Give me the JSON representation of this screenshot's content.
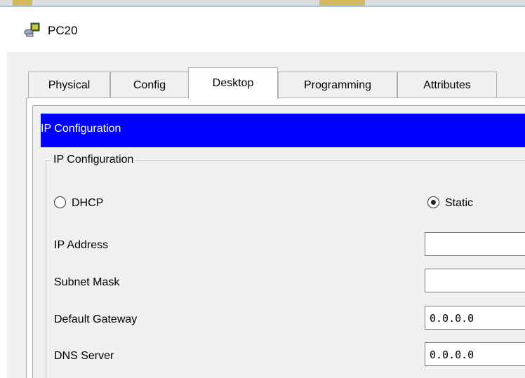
{
  "window": {
    "title": "PC20",
    "icon": "pc-device-icon"
  },
  "tabs": [
    {
      "label": "Physical",
      "active": false
    },
    {
      "label": "Config",
      "active": false
    },
    {
      "label": "Desktop",
      "active": true
    },
    {
      "label": "Programming",
      "active": false
    },
    {
      "label": "Attributes",
      "active": false
    }
  ],
  "ip_config": {
    "header": "IP Configuration",
    "group_label": "IP Configuration",
    "dhcp_label": "DHCP",
    "static_label": "Static",
    "selected_mode": "Static",
    "fields": {
      "ip_address": {
        "label": "IP Address",
        "value": ""
      },
      "subnet_mask": {
        "label": "Subnet Mask",
        "value": ""
      },
      "default_gateway": {
        "label": "Default Gateway",
        "value": "0.0.0.0"
      },
      "dns_server": {
        "label": "DNS Server",
        "value": "0.0.0.0"
      }
    }
  },
  "colors": {
    "header_bg": "#0000ff",
    "header_text": "#ffffff",
    "panel_bg": "#f0f0f0"
  }
}
